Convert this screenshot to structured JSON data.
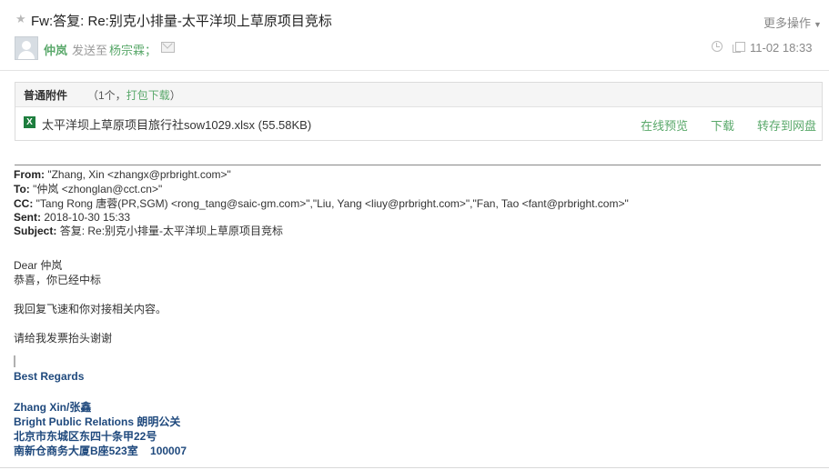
{
  "header": {
    "subject": "Fw:答复: Re:别克小排量-太平洋坝上草原项目竞标",
    "more_actions": "更多操作",
    "sender": "仲岚",
    "sent_to_label": "发送至",
    "recipient": "杨宗霖；",
    "datetime": "11-02 18:33",
    "icons": [
      "star-icon",
      "avatar-icon",
      "envelope-icon",
      "clock-icon",
      "copy-icon"
    ]
  },
  "attachments": {
    "title": "普通附件",
    "count_text": "（1个，",
    "download_all": "打包下载",
    "count_close": "）",
    "file": {
      "icon": "excel-file-icon",
      "badge": "X",
      "name": "太平洋坝上草原项目旅行社sow1029.xlsx (55.58KB)"
    },
    "actions": {
      "preview": "在线预览",
      "download": "下载",
      "save_to_disk": "转存到网盘"
    }
  },
  "quoted": {
    "from_label": "From:",
    "from_value": "\"Zhang, Xin <zhangx@prbright.com>\"",
    "to_label": "To:",
    "to_value": "\"仲岚 <zhonglan@cct.cn>\"",
    "cc_label": "CC:",
    "cc_value": "\"Tang Rong 唐蓉(PR,SGM) <rong_tang@saic-gm.com>\",\"Liu, Yang <liuy@prbright.com>\",\"Fan, Tao <fant@prbright.com>\"",
    "sent_label": "Sent:",
    "sent_value": "2018-10-30 15:33",
    "subject_label": "Subject:",
    "subject_value": "答复: Re:别克小排量-太平洋坝上草原项目竞标"
  },
  "body": {
    "greeting": "Dear  仲岚",
    "line1": "恭喜，你已经中标",
    "line2": "我回复飞速和你对接相关内容。",
    "line3": "请给我发票抬头谢谢"
  },
  "signature": {
    "regards": "Best Regards",
    "name": "Zhang Xin/张鑫",
    "company": "Bright Public Relations 朗明公关",
    "address1": "北京市东城区东四十条甲22号",
    "address2": "南新仓商务大厦B座523室    100007",
    "color": "#1f497d"
  },
  "colors": {
    "accent": "#59a86a"
  }
}
